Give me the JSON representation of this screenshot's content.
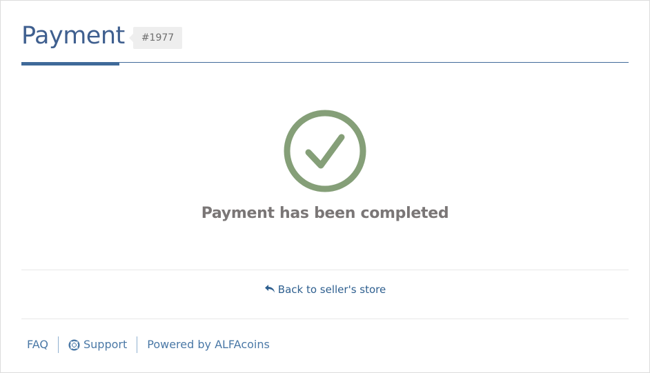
{
  "header": {
    "title": "Payment",
    "order_badge": "#1977"
  },
  "status": {
    "icon": "check-circle-icon",
    "message": "Payment has been completed",
    "color": "#859f78"
  },
  "back": {
    "icon": "reply-icon",
    "label": "Back to seller's store"
  },
  "footer": {
    "faq": "FAQ",
    "support_icon": "lifebuoy-icon",
    "support": "Support",
    "powered_by": "Powered by ALFAcoins"
  },
  "colors": {
    "accent": "#3f6a99",
    "title": "#3f5f8f",
    "link": "#2e5f8f",
    "success": "#859f78"
  }
}
